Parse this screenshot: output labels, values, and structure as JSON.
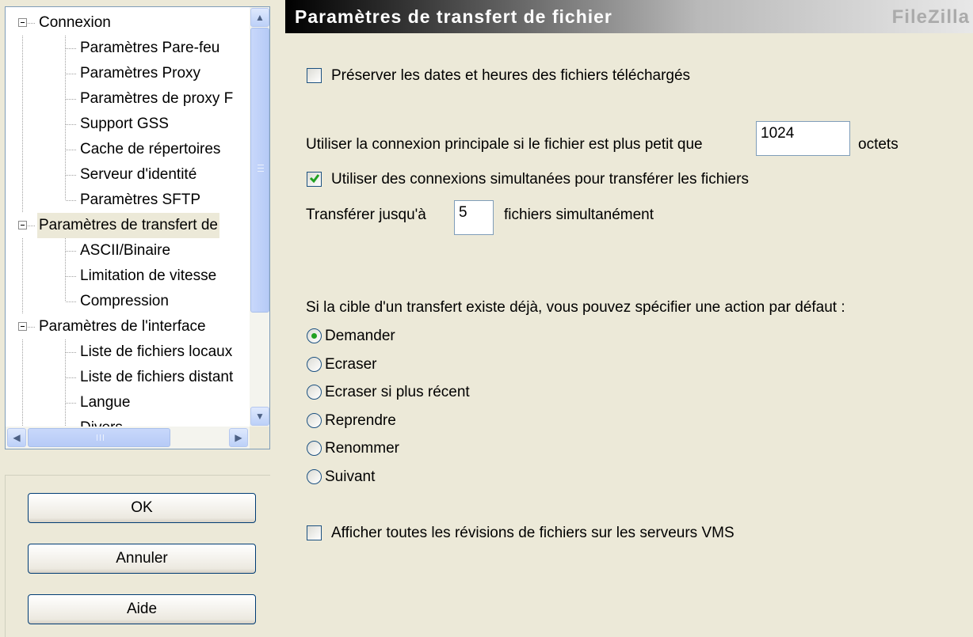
{
  "tree": {
    "items": [
      {
        "label": "Connexion",
        "level": 0,
        "expanded": true
      },
      {
        "label": "Paramètres Pare-feu",
        "level": 1
      },
      {
        "label": "Paramètres Proxy",
        "level": 1
      },
      {
        "label": "Paramètres de proxy F",
        "level": 1
      },
      {
        "label": "Support GSS",
        "level": 1
      },
      {
        "label": "Cache de répertoires",
        "level": 1
      },
      {
        "label": "Serveur d'identité",
        "level": 1
      },
      {
        "label": "Paramètres SFTP",
        "level": 1
      },
      {
        "label": "Paramètres de transfert de",
        "level": 0,
        "expanded": true,
        "selected": true
      },
      {
        "label": "ASCII/Binaire",
        "level": 1
      },
      {
        "label": "Limitation de vitesse",
        "level": 1
      },
      {
        "label": "Compression",
        "level": 1
      },
      {
        "label": "Paramètres de l'interface",
        "level": 0,
        "expanded": true
      },
      {
        "label": "Liste de fichiers locaux",
        "level": 1
      },
      {
        "label": "Liste de fichiers distant",
        "level": 1
      },
      {
        "label": "Langue",
        "level": 1
      },
      {
        "label": "Divers",
        "level": 1
      }
    ]
  },
  "buttons": {
    "ok": "OK",
    "cancel": "Annuler",
    "help": "Aide"
  },
  "page": {
    "title": "Paramètres de transfert de fichier",
    "brand": "FileZilla",
    "preserve_dates": {
      "label": "Préserver les dates et heures des fichiers téléchargés",
      "checked": false
    },
    "main_conn_before": "Utiliser la connexion principale si le fichier est plus petit que",
    "main_conn_value": "1024",
    "main_conn_unit": "octets",
    "simultaneous": {
      "label": "Utiliser des connexions simultanées pour transférer les fichiers",
      "checked": true
    },
    "transfer_before": "Transférer jusqu'à",
    "transfer_value": "5",
    "transfer_after": "fichiers simultanément",
    "exists_prompt": "Si la cible d'un transfert existe déjà, vous pouvez spécifier une action par défaut :",
    "actions": [
      {
        "label": "Demander",
        "selected": true
      },
      {
        "label": "Ecraser",
        "selected": false
      },
      {
        "label": "Ecraser si plus récent",
        "selected": false
      },
      {
        "label": "Reprendre",
        "selected": false
      },
      {
        "label": "Renommer",
        "selected": false
      },
      {
        "label": "Suivant",
        "selected": false
      }
    ],
    "vms": {
      "label": "Afficher toutes les révisions de fichiers sur les serveurs VMS",
      "checked": false
    }
  },
  "colors": {
    "check_accent": "#21a121",
    "border": "#1c5180"
  }
}
